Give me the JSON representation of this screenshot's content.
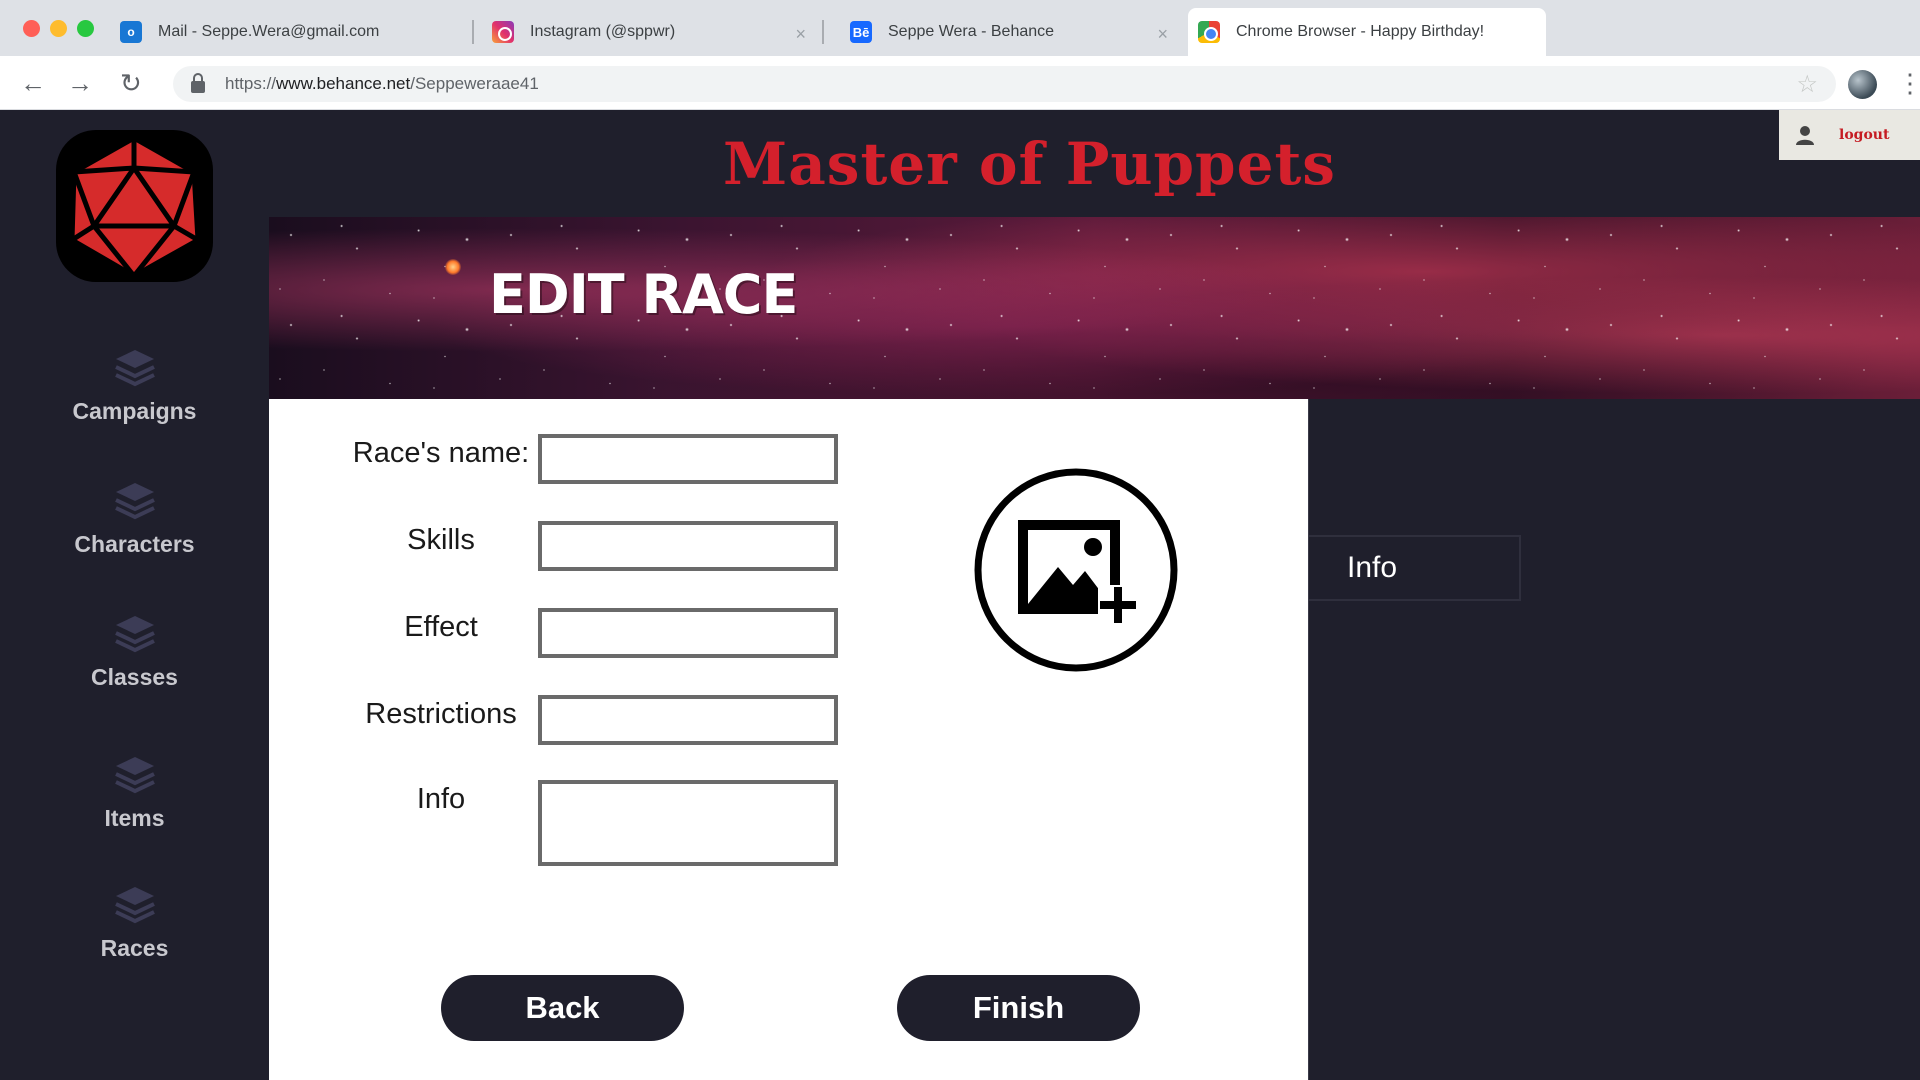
{
  "browser": {
    "tabs": [
      {
        "title": "Mail - Seppe.Wera@gmail.com",
        "icon": "outlook-icon",
        "favicon_text": "o"
      },
      {
        "title": "Instagram (@sppwr)",
        "icon": "instagram-icon"
      },
      {
        "title": "Seppe Wera - Behance",
        "icon": "behance-icon",
        "favicon_text": "Bē"
      },
      {
        "title": "Chrome Browser - Happy Birthday!",
        "icon": "chrome-icon"
      }
    ],
    "active_tab": 3,
    "url_scheme": "https://",
    "url_host": "www.behance.net",
    "url_path": "/Seppeweraae41"
  },
  "app": {
    "title": "Master of Puppets",
    "logout_label": "logout",
    "accent_color": "#d4202c",
    "sidebar": {
      "items": [
        {
          "label": "Campaigns",
          "icon": "layers-icon"
        },
        {
          "label": "Characters",
          "icon": "layers-icon"
        },
        {
          "label": "Classes",
          "icon": "layers-icon"
        },
        {
          "label": "Items",
          "icon": "layers-icon"
        },
        {
          "label": "Races",
          "icon": "layers-icon"
        }
      ]
    },
    "page_heading": "EDIT RACE",
    "form": {
      "fields": [
        {
          "label": "Race's name:",
          "value": ""
        },
        {
          "label": "Skills",
          "value": ""
        },
        {
          "label": "Effect",
          "value": ""
        },
        {
          "label": "Restrictions",
          "value": ""
        },
        {
          "label": "Info",
          "value": ""
        }
      ],
      "add_image_icon": "add-image-icon",
      "back_label": "Back",
      "finish_label": "Finish"
    },
    "right_panel": {
      "info_tab_label": "Info"
    }
  }
}
